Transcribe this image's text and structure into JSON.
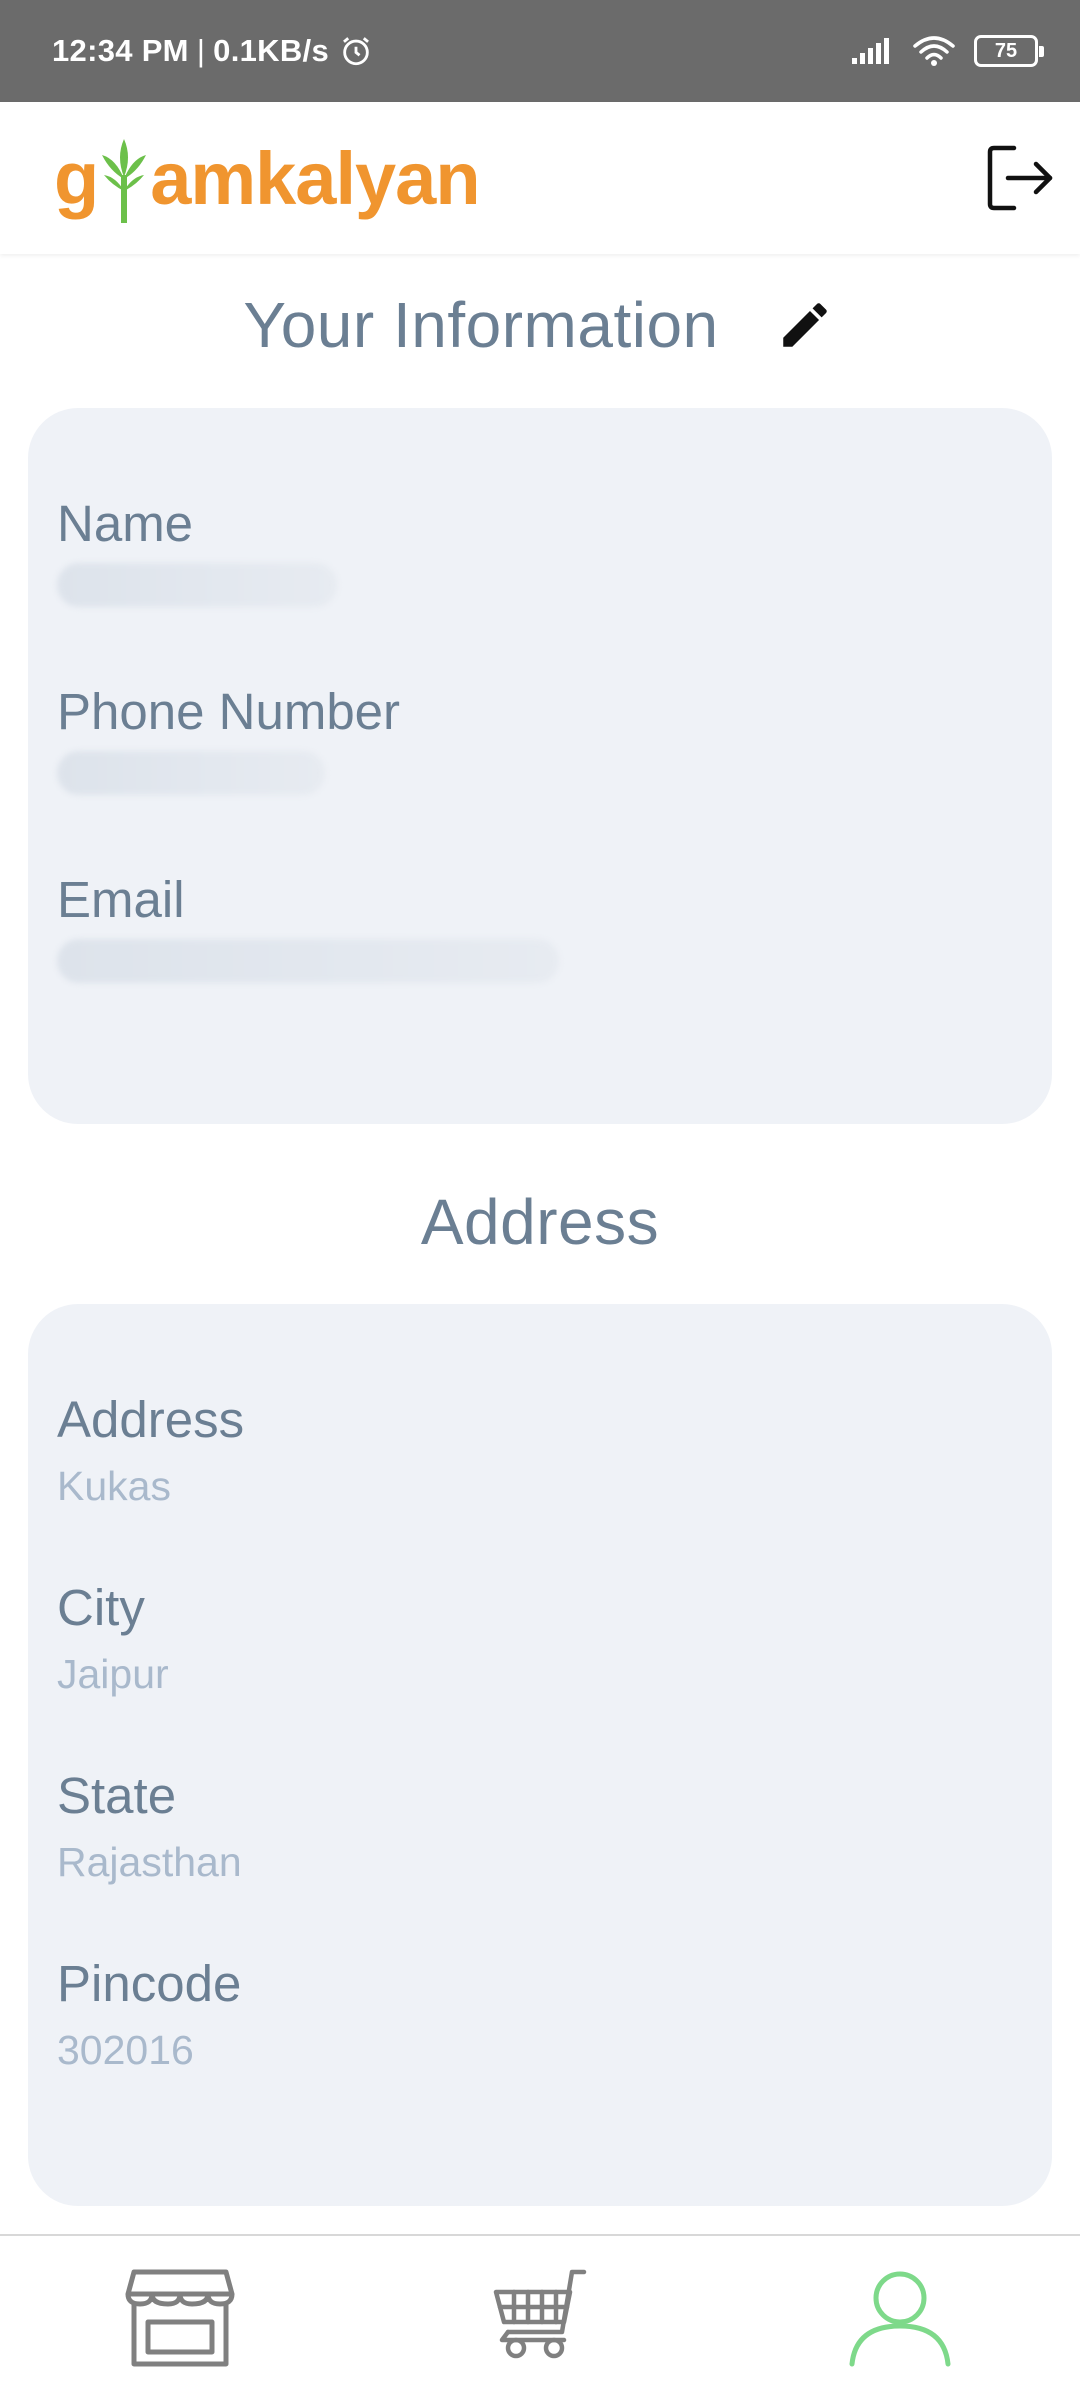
{
  "status_bar": {
    "time": "12:34 PM",
    "separator": "|",
    "network_speed": "0.1KB/s",
    "battery_level": "75",
    "icons": [
      "alarm-icon",
      "signal-icon",
      "wifi-icon",
      "battery-icon"
    ]
  },
  "header": {
    "logo_text_start": "g",
    "logo_text_end": "amkalyan",
    "logo_colors": {
      "text": "#f0952f",
      "leaf": "#6cc04a"
    },
    "logout_icon": "logout-icon"
  },
  "info_section": {
    "title": "Your Information",
    "edit_icon": "pencil-icon",
    "fields": [
      {
        "label": "Name"
      },
      {
        "label": "Phone Number"
      },
      {
        "label": "Email"
      }
    ]
  },
  "address_section": {
    "title": "Address",
    "fields": [
      {
        "label": "Address",
        "value": "Kukas"
      },
      {
        "label": "City",
        "value": "Jaipur"
      },
      {
        "label": "State",
        "value": "Rajasthan"
      },
      {
        "label": "Pincode",
        "value": "302016"
      }
    ]
  },
  "bottom_nav": {
    "items": [
      {
        "icon": "store-icon",
        "active": false
      },
      {
        "icon": "cart-icon",
        "active": false
      },
      {
        "icon": "profile-icon",
        "active": true
      }
    ],
    "colors": {
      "inactive": "#808080",
      "active": "#7ed98a"
    }
  },
  "colors": {
    "status_bar": "#6b6b6b",
    "title_text": "#6b7f93",
    "card_background": "#eff2f7",
    "value_text": "#a9b9cc"
  }
}
